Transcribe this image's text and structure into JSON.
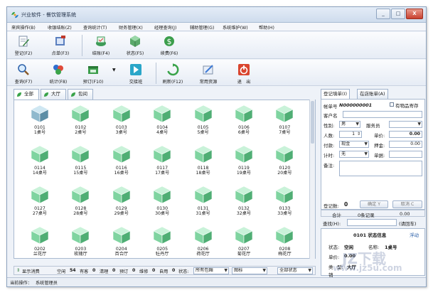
{
  "window": {
    "title": "兴业软件 - 餐饮管理系统",
    "minimize": "_",
    "maximize": "□",
    "close": "X"
  },
  "menu": [
    "来宾操作(B)",
    "收银结账(Z)",
    "查询统计(T)",
    "财务管理(X)",
    "经理查询(J)",
    "辅助管理(G)",
    "系统维护(W)",
    "帮助(H)"
  ],
  "toolbar1": [
    {
      "label": "登记(F2)",
      "icon": "register-icon"
    },
    {
      "label": "点单(F3)",
      "icon": "order-icon"
    },
    {
      "label": "结账(F4)",
      "icon": "checkout-icon"
    },
    {
      "label": "状态(F5)",
      "icon": "status-icon"
    },
    {
      "label": "续费(F6)",
      "icon": "renew-icon"
    }
  ],
  "toolbar2": [
    {
      "label": "查询(F7)",
      "icon": "search-icon"
    },
    {
      "label": "统计(F8)",
      "icon": "stats-icon"
    },
    {
      "label": "预订(F10)",
      "icon": "reserve-icon"
    },
    {
      "label": "交接班",
      "icon": "shift-icon"
    },
    {
      "label": "刷新(F12)",
      "icon": "refresh-icon"
    },
    {
      "label": "常用资源",
      "icon": "resources-icon"
    },
    {
      "label": "退　出",
      "icon": "exit-icon"
    }
  ],
  "area_tabs": [
    "全部",
    "大厅",
    "包间"
  ],
  "tables": [
    {
      "num": "0101",
      "name": "1桌号",
      "selected": true
    },
    {
      "num": "0102",
      "name": "2桌号"
    },
    {
      "num": "0103",
      "name": "3桌号"
    },
    {
      "num": "0104",
      "name": "4桌号"
    },
    {
      "num": "0105",
      "name": "5桌号"
    },
    {
      "num": "0106",
      "name": "6桌号"
    },
    {
      "num": "0107",
      "name": "7桌号"
    },
    {
      "num": "0114",
      "name": "14桌号"
    },
    {
      "num": "0115",
      "name": "15桌号"
    },
    {
      "num": "0116",
      "name": "16桌号"
    },
    {
      "num": "0117",
      "name": "17桌号"
    },
    {
      "num": "0118",
      "name": "18桌号"
    },
    {
      "num": "0119",
      "name": "19桌号"
    },
    {
      "num": "0120",
      "name": "20桌号"
    },
    {
      "num": "0127",
      "name": "27桌号"
    },
    {
      "num": "0128",
      "name": "28桌号"
    },
    {
      "num": "0129",
      "name": "29桌号"
    },
    {
      "num": "0130",
      "name": "30桌号"
    },
    {
      "num": "0131",
      "name": "31桌号"
    },
    {
      "num": "0132",
      "name": "32桌号"
    },
    {
      "num": "0133",
      "name": "33桌号"
    },
    {
      "num": "0202",
      "name": "兰花厅"
    },
    {
      "num": "0203",
      "name": "玫瑰厅"
    },
    {
      "num": "0204",
      "name": "百合厅"
    },
    {
      "num": "0205",
      "name": "牡丹厅"
    },
    {
      "num": "0206",
      "name": "荷花厅"
    },
    {
      "num": "0207",
      "name": "菊花厅"
    },
    {
      "num": "0208",
      "name": "梅花厅"
    }
  ],
  "status_bar": {
    "toggle": "显示消费",
    "kong_label": "空闲",
    "kong": "54",
    "you_label": "有客",
    "you": "0",
    "qing_label": "清理",
    "qing": "0",
    "yu_label": "预订",
    "yu": "0",
    "wei_label": "维修",
    "wei": "0",
    "zi_label": "自用",
    "zi": "0",
    "state_label": "状态:",
    "area_select": "所有包厢",
    "view_select": "图标",
    "status_select": "全部状态"
  },
  "footer": {
    "operator_label": "当前操作：",
    "operator": "系统管理员"
  },
  "right_tabs": [
    "登记填单(I)",
    "在店账单(A)"
  ],
  "form": {
    "bill_label": "帐单号",
    "bill_no": "N000000001",
    "deposit_label": "有物品寄存",
    "customer_label": "客户名",
    "customer": "",
    "gender_label": "性别:",
    "gender": "男",
    "waiter_label": "服务员",
    "waiter": "",
    "people_label": "人数:",
    "people": "1",
    "price_label": "单价:",
    "price": "0.00",
    "pay_label": "付款:",
    "pay": "现金",
    "deposit_money_label": "押金:",
    "deposit_money": "0.00",
    "timing_label": "计时:",
    "timing": "无",
    "card_label": "单据:",
    "card": "",
    "remark_label": "备注:",
    "count_label": "登记数:",
    "count": "0",
    "confirm": "确定 Y",
    "cancel": "取消 C"
  },
  "summary": {
    "total_label": "合计",
    "records": "0条记录",
    "amount": "0.00"
  },
  "find": {
    "label": "查找(H):",
    "value": "",
    "hint": "(请回车)"
  },
  "info": {
    "title": "0101 状态信息",
    "float_label": "浮动",
    "state_label": "状态:",
    "state": "空闲",
    "name_label": "名称:",
    "name": "1桌号",
    "price_label": "单价:",
    "price": "0.00",
    "type_label": "类",
    "area_label": "型:",
    "area": "大厅",
    "extra_label": "销"
  },
  "watermark": {
    "text1": "JZ下载",
    "text2": "www.jz5u.com"
  },
  "colors": {
    "accent": "#2a5fa8",
    "cube_top": "#c9f2d9",
    "cube_left": "#7fd4a0",
    "cube_right": "#4fae74",
    "cube_selected_top": "#cfe7f2",
    "cube_selected_left": "#8fb9cd",
    "cube_selected_right": "#5d8ea6"
  }
}
